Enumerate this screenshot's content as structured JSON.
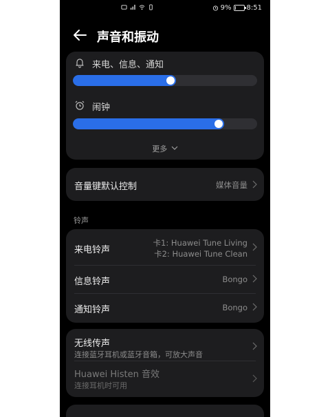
{
  "status_bar": {
    "center_icons": [
      "sim-icon",
      "signal-icon",
      "wifi-icon",
      "vibrate-icon"
    ],
    "right_text": "9%",
    "battery_level": 0.09,
    "time": "8:51"
  },
  "header": {
    "title": "声音和振动"
  },
  "volume": {
    "ring": {
      "label": "来电、信息、通知",
      "level": 0.56
    },
    "alarm": {
      "label": "闹钟",
      "level": 0.82
    },
    "more_label": "更多"
  },
  "volume_key": {
    "label": "音量键默认控制",
    "value": "媒体音量"
  },
  "ringtone_section": {
    "label": "铃声"
  },
  "ringtones": {
    "call": {
      "label": "来电铃声",
      "value_line1": "卡1: Huawei Tune Living",
      "value_line2": "卡2: Huawei Tune Clean"
    },
    "message": {
      "label": "信息铃声",
      "value": "Bongo"
    },
    "notification": {
      "label": "通知铃声",
      "value": "Bongo"
    }
  },
  "wireless": {
    "title": "无线传声",
    "subtitle": "连接蓝牙耳机或蓝牙音箱，可放大声音",
    "histen_title": "Huawei Histen 音效",
    "histen_subtitle": "连接耳机时可用"
  },
  "colors": {
    "accent": "#2a6ee8",
    "card": "#1d1d1f",
    "background": "#000000"
  }
}
